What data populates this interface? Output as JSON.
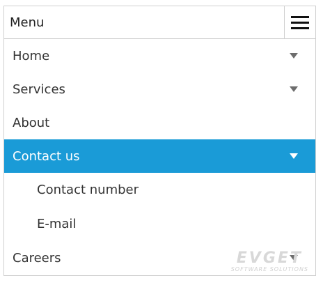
{
  "header": {
    "title": "Menu",
    "toggle_icon": "hamburger-icon"
  },
  "menu": {
    "items": [
      {
        "label": "Home",
        "has_submenu": true
      },
      {
        "label": "Services",
        "has_submenu": true
      },
      {
        "label": "About",
        "has_submenu": false
      },
      {
        "label": "Contact us",
        "has_submenu": true,
        "active": true,
        "expanded": true
      },
      {
        "label": "Contact number",
        "submenu_of": "Contact us"
      },
      {
        "label": "E-mail",
        "submenu_of": "Contact us"
      },
      {
        "label": "Careers",
        "has_submenu": true
      }
    ]
  },
  "watermark": {
    "main": "EVGET",
    "sub": "SOFTWARE SOLUTIONS"
  },
  "colors": {
    "active_bg": "#1a9bd7",
    "active_text": "#ffffff",
    "text": "#333333",
    "border": "#cfcfcf",
    "caret": "#6d6d6d"
  }
}
